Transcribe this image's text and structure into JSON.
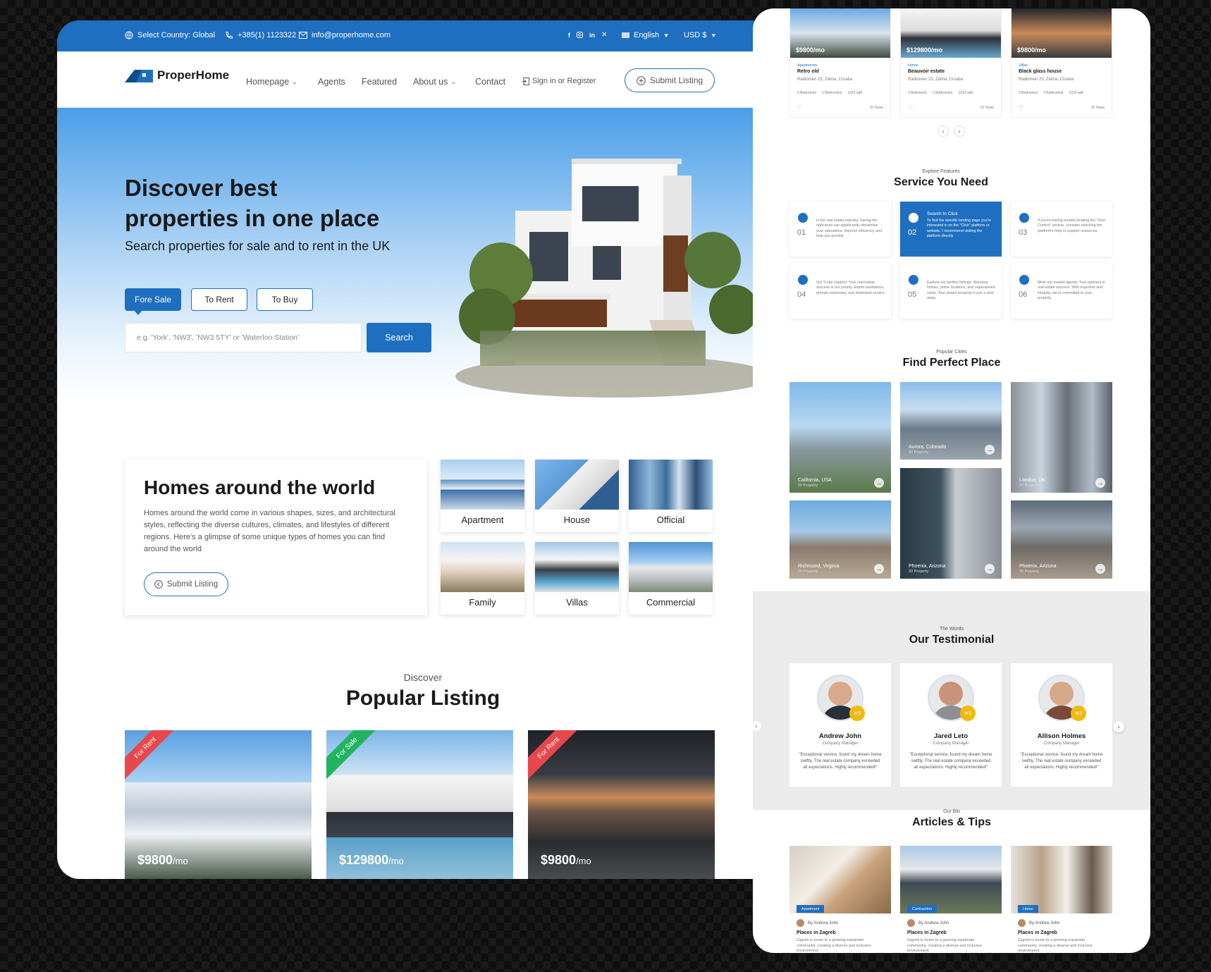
{
  "topbar": {
    "country": "Select Country: Global",
    "phone": "+385(1) 1123322",
    "email": "info@properhome.com",
    "language": "English",
    "currency": "USD $"
  },
  "nav": {
    "logo": "ProperHome",
    "items": [
      "Homepage",
      "Agents",
      "Featured",
      "About us",
      "Contact"
    ],
    "signin": "Sign in or Register",
    "submit": "Submit Listing"
  },
  "hero": {
    "title_line1": "Discover best",
    "title_line2": "properties in one place",
    "subtitle": "Search properties for sale and to rent in the UK",
    "tabs": [
      "Fore Sale",
      "To Rent",
      "To Buy"
    ],
    "search_placeholder": "e.g. 'York', 'NW3', 'NW3 5TY' or 'Waterloo Station'",
    "search_button": "Search"
  },
  "homes": {
    "title": "Homes around the world",
    "description": "Homes around the world come in various shapes, sizes, and architectural styles, reflecting the diverse cultures, climates, and lifestyles of different regions. Here's a glimpse of some unique types of homes you can find around the world",
    "button": "Submit Listing",
    "categories": [
      "Apartment",
      "House",
      "Official",
      "Family",
      "Villas",
      "Commercial"
    ]
  },
  "popular": {
    "kicker": "Discover",
    "title": "Popular Listing",
    "listings": [
      {
        "badge": "For Rent",
        "price": "$9800",
        "unit": "/mo",
        "badge_color": "#e8474b"
      },
      {
        "badge": "For Sale",
        "price": "$129800",
        "unit": "/mo",
        "badge_color": "#22b35e"
      },
      {
        "badge": "For Rent",
        "price": "$9800",
        "unit": "/mo",
        "badge_color": "#e8474b"
      }
    ]
  },
  "right": {
    "listings": [
      {
        "price": "$9800/mo",
        "type": "Apartments",
        "name": "Retro old",
        "addr": "Radiomen 23, Zelina, Croatia",
        "beds": "3 Bedrooms",
        "baths": "2 Bathrooms",
        "size": "1010 sqft",
        "years": "10 Years"
      },
      {
        "price": "$129800/mo",
        "type": "Home",
        "name": "Beauvoir estate",
        "addr": "Radiomen 23, Zelina, Croatia",
        "beds": "3 Bedrooms",
        "baths": "2 Bathrooms",
        "size": "1010 sqft",
        "years": "10 Years"
      },
      {
        "price": "$9800/mo",
        "type": "Villas",
        "name": "Black glass house",
        "addr": "Radiomen 23, Zelina, Croatia",
        "beds": "3 Bedrooms",
        "baths": "2 Bathrooms",
        "size": "1010 sqft",
        "years": "10 Years"
      }
    ],
    "services": {
      "kicker": "Explore Features",
      "title": "Service You Need",
      "items": [
        {
          "num": "01",
          "title": "",
          "text": "In the real estate industry, having the right tools can significantly streamline your operations, improve efficiency, and help you provide"
        },
        {
          "num": "02",
          "title": "Search In Click",
          "text": "To find the specific landing page you're interested in on the \"Click\" platform or website, I recommend visiting the platform directly"
        },
        {
          "num": "03",
          "title": "",
          "text": "If you're having trouble locating the \"User Control\" section, consider checking the platform's help or support resources."
        },
        {
          "num": "04",
          "title": "",
          "text": "Our 5-star support: Your real estate success is our priority. Expert assistance, prompt responses, and dedicated service"
        },
        {
          "num": "05",
          "title": "",
          "text": "Explore our perfect listings: Stunning homes, prime locations, and unparalleled value. Your dream property is just a click away."
        },
        {
          "num": "06",
          "title": "",
          "text": "Meet our trusted agents: Your partners in real estate success. With expertise and integrity, we're committed to your property"
        }
      ]
    },
    "cities": {
      "kicker": "Popular Cities",
      "title": "Find Perfect Place",
      "items": [
        {
          "name": "California, USA",
          "count": "20 Property"
        },
        {
          "name": "Aurora, Colorado",
          "count": "20 Property"
        },
        {
          "name": "London, UK",
          "count": "20 Property"
        },
        {
          "name": "Richmond, Virginia",
          "count": "20 Property"
        },
        {
          "name": "Phoenix, Arizona",
          "count": "20 Property"
        },
        {
          "name": "Phoenix, Arizona",
          "count": "20 Property"
        }
      ]
    },
    "testimonial": {
      "kicker": "The Words",
      "title": "Our Testimonial",
      "items": [
        {
          "name": "Andrew John",
          "role": "Company Manager",
          "rating": "5",
          "quote": "\"Exceptional service, found my dream home swiftly. The real estate company exceeded all expectations. Highly recommended!\""
        },
        {
          "name": "Jared Leto",
          "role": "Company Manager",
          "rating": "5",
          "quote": "\"Exceptional service, found my dream home swiftly. The real estate company exceeded all expectations. Highly recommended!\""
        },
        {
          "name": "Allison Holmes",
          "role": "Company Manager",
          "rating": "5",
          "quote": "\"Exceptional service, found my dream home swiftly. The real estate company exceeded all expectations. Highly recommended!\""
        }
      ]
    },
    "articles": {
      "kicker": "Our Blo",
      "title": "Articles & Tips",
      "items": [
        {
          "badge": "Apartment",
          "author": "By Andrew John",
          "title": "Places in Zagreb",
          "text": "Zagreb is home to a growing expatriate community, creating a diverse and inclusive environment."
        },
        {
          "badge": "Contraction",
          "author": "By Andrew John",
          "title": "Places in Zagreb",
          "text": "Zagreb is home to a growing expatriate community, creating a diverse and inclusive environment."
        },
        {
          "badge": "Home",
          "author": "By Andrew John",
          "title": "Places in Zagreb",
          "text": "Zagreb is home to a growing expatriate community, creating a diverse and inclusive environment."
        }
      ]
    }
  },
  "colors": {
    "primary": "#1f6fc0",
    "rent": "#e8474b",
    "sale": "#22b35e",
    "star": "#f2b90f"
  }
}
